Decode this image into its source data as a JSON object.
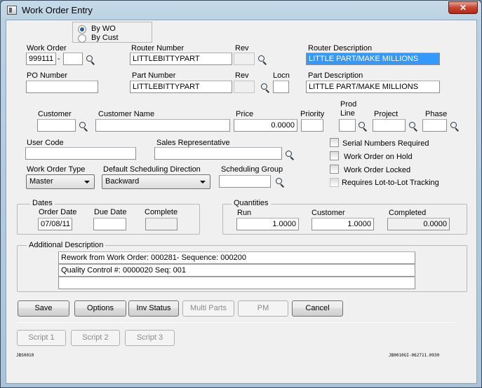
{
  "window": {
    "title": "Work Order Entry",
    "close_label": "✕"
  },
  "lookup_mode": {
    "options": [
      "By WO",
      "By Cust"
    ],
    "selected": "By WO"
  },
  "labels": {
    "work_order": "Work Order",
    "router_number": "Router Number",
    "rev": "Rev",
    "router_description": "Router Description",
    "po_number": "PO Number",
    "part_number": "Part Number",
    "locn": "Locn",
    "part_description": "Part Description",
    "customer": "Customer",
    "customer_name": "Customer Name",
    "price": "Price",
    "priority": "Priority",
    "prod_line": "Prod\nLine",
    "project": "Project",
    "phase": "Phase",
    "user_code": "User Code",
    "sales_rep": "Sales Representative",
    "wo_type": "Work Order Type",
    "sched_direction": "Default Scheduling Direction",
    "sched_group": "Scheduling Group",
    "dash": "-"
  },
  "fields": {
    "work_order": "999111",
    "work_order_suffix": "",
    "router_number": "LITTLEBITTYPART",
    "router_rev": "",
    "router_description": "LITTLE PART/MAKE MILLIONS",
    "po_number": "",
    "part_number": "LITTLEBITTYPART",
    "part_rev": "",
    "locn": "",
    "part_description": "LITTLE PART/MAKE MILLIONS",
    "customer": "",
    "customer_name": "",
    "price": "0.0000",
    "priority": "",
    "prod_line": "",
    "project": "",
    "phase": "",
    "user_code": "",
    "sales_rep": "",
    "sched_group": ""
  },
  "selects": {
    "wo_type": "Master",
    "sched_direction": "Backward"
  },
  "checkboxes": [
    {
      "label": "Serial Numbers Required",
      "checked": false,
      "enabled": true
    },
    {
      "label": "Work Order on Hold",
      "checked": false,
      "enabled": true
    },
    {
      "label": "Work Order Locked",
      "checked": false,
      "enabled": true
    },
    {
      "label": "Requires Lot-to-Lot Tracking",
      "checked": false,
      "enabled": false
    }
  ],
  "dates": {
    "title": "Dates",
    "order_date_label": "Order Date",
    "due_date_label": "Due Date",
    "complete_label": "Complete",
    "order_date": "07/08/11",
    "due_date": "",
    "complete": ""
  },
  "quantities": {
    "title": "Quantities",
    "run_label": "Run",
    "customer_label": "Customer",
    "completed_label": "Completed",
    "run": "1.0000",
    "customer": "1.0000",
    "completed": "0.0000"
  },
  "additional": {
    "title": "Additional Description",
    "lines": [
      "Rework from Work Order: 000281-    Sequence: 000200",
      "Quality Control #: 0000020 Seq: 001",
      ""
    ]
  },
  "buttons": [
    {
      "label": "Save",
      "enabled": true
    },
    {
      "label": "Options",
      "enabled": true
    },
    {
      "label": "Inv Status",
      "enabled": true
    },
    {
      "label": "Multi Parts",
      "enabled": false
    },
    {
      "label": "PM",
      "enabled": false
    },
    {
      "label": "Cancel",
      "enabled": true
    }
  ],
  "scripts": [
    "Script 1",
    "Script 2",
    "Script 3"
  ],
  "footer": {
    "left": "JBS0010",
    "right": "JB0010GI-062711.0930"
  }
}
